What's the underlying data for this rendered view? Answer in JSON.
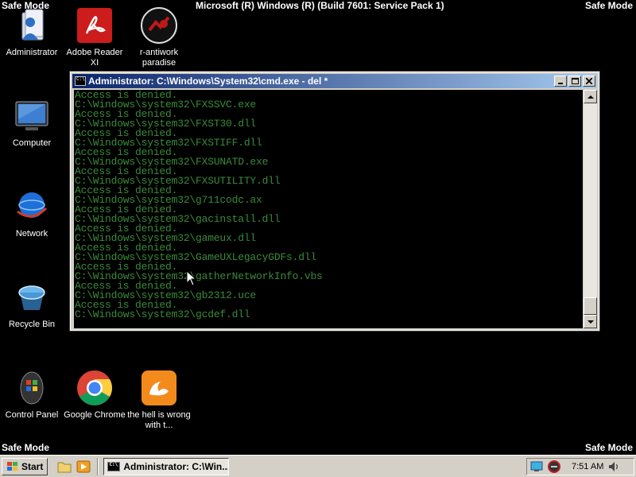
{
  "screen": {
    "safe_mode_label": "Safe Mode",
    "build_text": "Microsoft (R) Windows (R) (Build 7601: Service Pack 1)"
  },
  "desktop_icons": [
    {
      "label": "Administrator",
      "icon": "user-folder-icon"
    },
    {
      "label": "Adobe Reader XI",
      "icon": "adobe-reader-icon"
    },
    {
      "label": "r-antiwork paradise",
      "icon": "r-antiwork-icon"
    },
    {
      "label": "Computer",
      "icon": "computer-icon"
    },
    {
      "label": "Network",
      "icon": "network-icon"
    },
    {
      "label": "Recycle Bin",
      "icon": "recycle-bin-icon"
    },
    {
      "label": "Control Panel",
      "icon": "control-panel-icon"
    },
    {
      "label": "Google Chrome",
      "icon": "chrome-icon"
    },
    {
      "label": "the hell is wrong with t...",
      "icon": "uc-browser-icon"
    }
  ],
  "cmd_window": {
    "title": "Administrator: C:\\Windows\\System32\\cmd.exe - del  *",
    "lines": [
      "Access is denied.",
      "C:\\Windows\\system32\\FXSSVC.exe",
      "Access is denied.",
      "C:\\Windows\\system32\\FXST30.dll",
      "Access is denied.",
      "C:\\Windows\\system32\\FXSTIFF.dll",
      "Access is denied.",
      "C:\\Windows\\system32\\FXSUNATD.exe",
      "Access is denied.",
      "C:\\Windows\\system32\\FXSUTILITY.dll",
      "Access is denied.",
      "C:\\Windows\\system32\\g711codc.ax",
      "Access is denied.",
      "C:\\Windows\\system32\\gacinstall.dll",
      "Access is denied.",
      "C:\\Windows\\system32\\gameux.dll",
      "Access is denied.",
      "C:\\Windows\\system32\\GameUXLegacyGDFs.dll",
      "Access is denied.",
      "C:\\Windows\\system32\\gatherNetworkInfo.vbs",
      "Access is denied.",
      "C:\\Windows\\system32\\gb2312.uce",
      "Access is denied.",
      "C:\\Windows\\system32\\gcdef.dll"
    ]
  },
  "taskbar": {
    "start_label": "Start",
    "task_label": "Administrator: C:\\Win...",
    "clock": "7:51 AM"
  }
}
